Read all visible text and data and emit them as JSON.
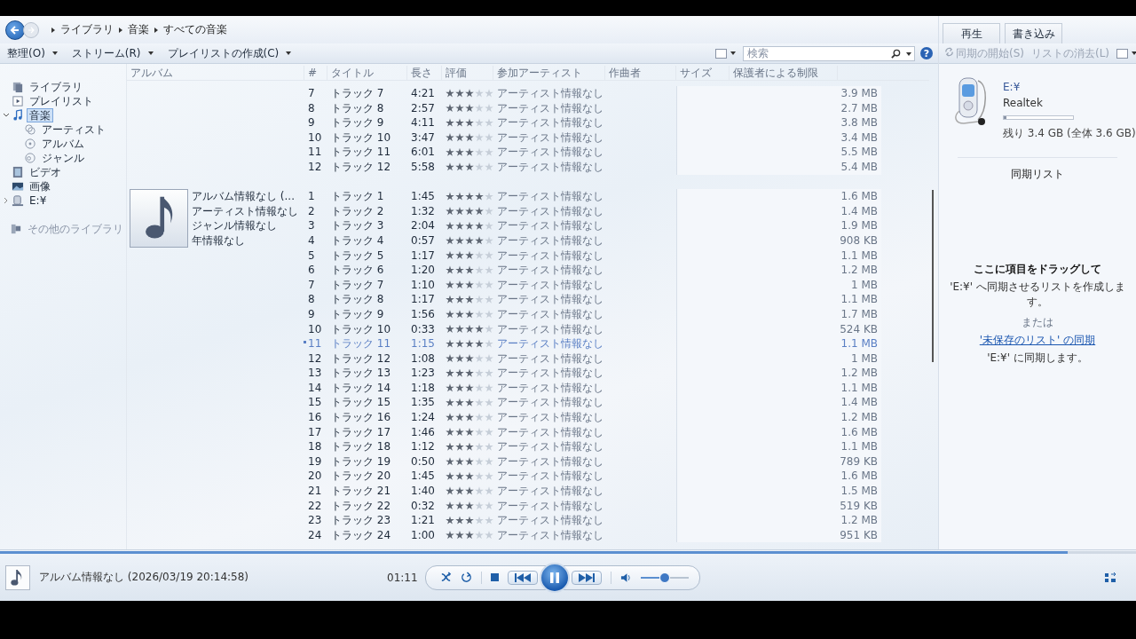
{
  "nav": {
    "breadcrumb": [
      "ライブラリ",
      "音楽",
      "すべての音楽"
    ]
  },
  "toolbar": {
    "menus": [
      "整理(O)",
      "ストリーム(R)",
      "プレイリストの作成(C)"
    ],
    "search": {
      "placeholder": "検索"
    },
    "help": "?"
  },
  "panel_tabs": [
    {
      "label": "再生",
      "selected": false
    },
    {
      "label": "書き込み",
      "selected": false
    }
  ],
  "sync_toolbar": {
    "buttons": [
      {
        "label": "同期の開始(S)",
        "disabled": true
      },
      {
        "label": "リストの消去(L)",
        "disabled": true
      }
    ]
  },
  "sidebar": {
    "items": [
      {
        "label": "ライブラリ",
        "kind": "library",
        "selected": false
      },
      {
        "label": "プレイリスト",
        "kind": "playlist",
        "selected": false
      },
      {
        "label": "音楽",
        "kind": "music",
        "selected": true,
        "expanded": true,
        "children": [
          {
            "label": "アーティスト",
            "kind": "artist",
            "selected": false
          },
          {
            "label": "アルバム",
            "kind": "album",
            "selected": false
          },
          {
            "label": "ジャンル",
            "kind": "genre",
            "selected": false
          }
        ]
      },
      {
        "label": "ビデオ",
        "kind": "video",
        "selected": false
      },
      {
        "label": "画像",
        "kind": "picture",
        "selected": false
      },
      {
        "label": "E:¥",
        "kind": "device",
        "selected": false,
        "expanded": false
      }
    ],
    "other": {
      "label": "その他のライブラリ",
      "kind": "other",
      "selected": false
    }
  },
  "table": {
    "columns": [
      "アルバム",
      "#",
      "タイトル",
      "長さ",
      "評価",
      "参加アーティスト",
      "作曲者",
      "サイズ",
      "保護者による制限"
    ],
    "groups": [
      {
        "tracks": [
          {
            "no": "7",
            "title": "トラック 7",
            "length": "4:21",
            "stars": 3,
            "artist": "アーティスト情報なし",
            "size": "3.9 MB",
            "playing": false
          },
          {
            "no": "8",
            "title": "トラック 8",
            "length": "2:57",
            "stars": 3,
            "artist": "アーティスト情報なし",
            "size": "2.7 MB",
            "playing": false
          },
          {
            "no": "9",
            "title": "トラック 9",
            "length": "4:11",
            "stars": 3,
            "artist": "アーティスト情報なし",
            "size": "3.8 MB",
            "playing": false
          },
          {
            "no": "10",
            "title": "トラック 10",
            "length": "3:47",
            "stars": 3,
            "artist": "アーティスト情報なし",
            "size": "3.4 MB",
            "playing": false
          },
          {
            "no": "11",
            "title": "トラック 11",
            "length": "6:01",
            "stars": 3,
            "artist": "アーティスト情報なし",
            "size": "5.5 MB",
            "playing": false
          },
          {
            "no": "12",
            "title": "トラック 12",
            "length": "5:58",
            "stars": 3,
            "artist": "アーティスト情報なし",
            "size": "5.4 MB",
            "playing": false
          }
        ]
      },
      {
        "album": [
          "アルバム情報なし (...",
          "アーティスト情報なし",
          "ジャンル情報なし",
          "年情報なし"
        ],
        "tracks": [
          {
            "no": "1",
            "title": "トラック 1",
            "length": "1:45",
            "stars": 4,
            "artist": "アーティスト情報なし",
            "size": "1.6 MB",
            "playing": false
          },
          {
            "no": "2",
            "title": "トラック 2",
            "length": "1:32",
            "stars": 4,
            "artist": "アーティスト情報なし",
            "size": "1.4 MB",
            "playing": false
          },
          {
            "no": "3",
            "title": "トラック 3",
            "length": "2:04",
            "stars": 4,
            "artist": "アーティスト情報なし",
            "size": "1.9 MB",
            "playing": false
          },
          {
            "no": "4",
            "title": "トラック 4",
            "length": "0:57",
            "stars": 4,
            "artist": "アーティスト情報なし",
            "size": "908 KB",
            "playing": false
          },
          {
            "no": "5",
            "title": "トラック 5",
            "length": "1:17",
            "stars": 3,
            "artist": "アーティスト情報なし",
            "size": "1.1 MB",
            "playing": false
          },
          {
            "no": "6",
            "title": "トラック 6",
            "length": "1:20",
            "stars": 3,
            "artist": "アーティスト情報なし",
            "size": "1.2 MB",
            "playing": false
          },
          {
            "no": "7",
            "title": "トラック 7",
            "length": "1:10",
            "stars": 3,
            "artist": "アーティスト情報なし",
            "size": "1 MB",
            "playing": false
          },
          {
            "no": "8",
            "title": "トラック 8",
            "length": "1:17",
            "stars": 3,
            "artist": "アーティスト情報なし",
            "size": "1.1 MB",
            "playing": false
          },
          {
            "no": "9",
            "title": "トラック 9",
            "length": "1:56",
            "stars": 3,
            "artist": "アーティスト情報なし",
            "size": "1.7 MB",
            "playing": false
          },
          {
            "no": "10",
            "title": "トラック 10",
            "length": "0:33",
            "stars": 4,
            "artist": "アーティスト情報なし",
            "size": "524 KB",
            "playing": false
          },
          {
            "no": "11",
            "title": "トラック 11",
            "length": "1:15",
            "stars": 4,
            "artist": "アーティスト情報なし",
            "size": "1.1 MB",
            "playing": true
          },
          {
            "no": "12",
            "title": "トラック 12",
            "length": "1:08",
            "stars": 3,
            "artist": "アーティスト情報なし",
            "size": "1 MB",
            "playing": false
          },
          {
            "no": "13",
            "title": "トラック 13",
            "length": "1:23",
            "stars": 3,
            "artist": "アーティスト情報なし",
            "size": "1.2 MB",
            "playing": false
          },
          {
            "no": "14",
            "title": "トラック 14",
            "length": "1:18",
            "stars": 3,
            "artist": "アーティスト情報なし",
            "size": "1.1 MB",
            "playing": false
          },
          {
            "no": "15",
            "title": "トラック 15",
            "length": "1:35",
            "stars": 3,
            "artist": "アーティスト情報なし",
            "size": "1.4 MB",
            "playing": false
          },
          {
            "no": "16",
            "title": "トラック 16",
            "length": "1:24",
            "stars": 3,
            "artist": "アーティスト情報なし",
            "size": "1.2 MB",
            "playing": false
          },
          {
            "no": "17",
            "title": "トラック 17",
            "length": "1:46",
            "stars": 3,
            "artist": "アーティスト情報なし",
            "size": "1.6 MB",
            "playing": false
          },
          {
            "no": "18",
            "title": "トラック 18",
            "length": "1:12",
            "stars": 3,
            "artist": "アーティスト情報なし",
            "size": "1.1 MB",
            "playing": false
          },
          {
            "no": "19",
            "title": "トラック 19",
            "length": "0:50",
            "stars": 3,
            "artist": "アーティスト情報なし",
            "size": "789 KB",
            "playing": false
          },
          {
            "no": "20",
            "title": "トラック 20",
            "length": "1:45",
            "stars": 3,
            "artist": "アーティスト情報なし",
            "size": "1.6 MB",
            "playing": false
          },
          {
            "no": "21",
            "title": "トラック 21",
            "length": "1:40",
            "stars": 3,
            "artist": "アーティスト情報なし",
            "size": "1.5 MB",
            "playing": false
          },
          {
            "no": "22",
            "title": "トラック 22",
            "length": "0:32",
            "stars": 3,
            "artist": "アーティスト情報なし",
            "size": "519 KB",
            "playing": false
          },
          {
            "no": "23",
            "title": "トラック 23",
            "length": "1:21",
            "stars": 3,
            "artist": "アーティスト情報なし",
            "size": "1.2 MB",
            "playing": false
          },
          {
            "no": "24",
            "title": "トラック 24",
            "length": "1:00",
            "stars": 3,
            "artist": "アーティスト情報なし",
            "size": "951 KB",
            "playing": false
          }
        ]
      }
    ]
  },
  "device": {
    "name": "E:¥",
    "vendor": "Realtek",
    "level": 0.04,
    "capacity": "残り 3.4 GB (全体 3.6 GB)"
  },
  "sync_list": {
    "title": "同期リスト",
    "hint_title": "ここに項目をドラッグして",
    "hint": "'E:¥' へ同期させるリストを作成します。",
    "or": "または",
    "link": "'未保存のリスト' の同期",
    "link_note": "'E:¥' に同期します。"
  },
  "player": {
    "now_playing": "アルバム情報なし (2026/03/19 20:14:58)",
    "time": "01:11",
    "level": 0.94,
    "playing": true,
    "volume": {
      "level": 0.48
    }
  }
}
